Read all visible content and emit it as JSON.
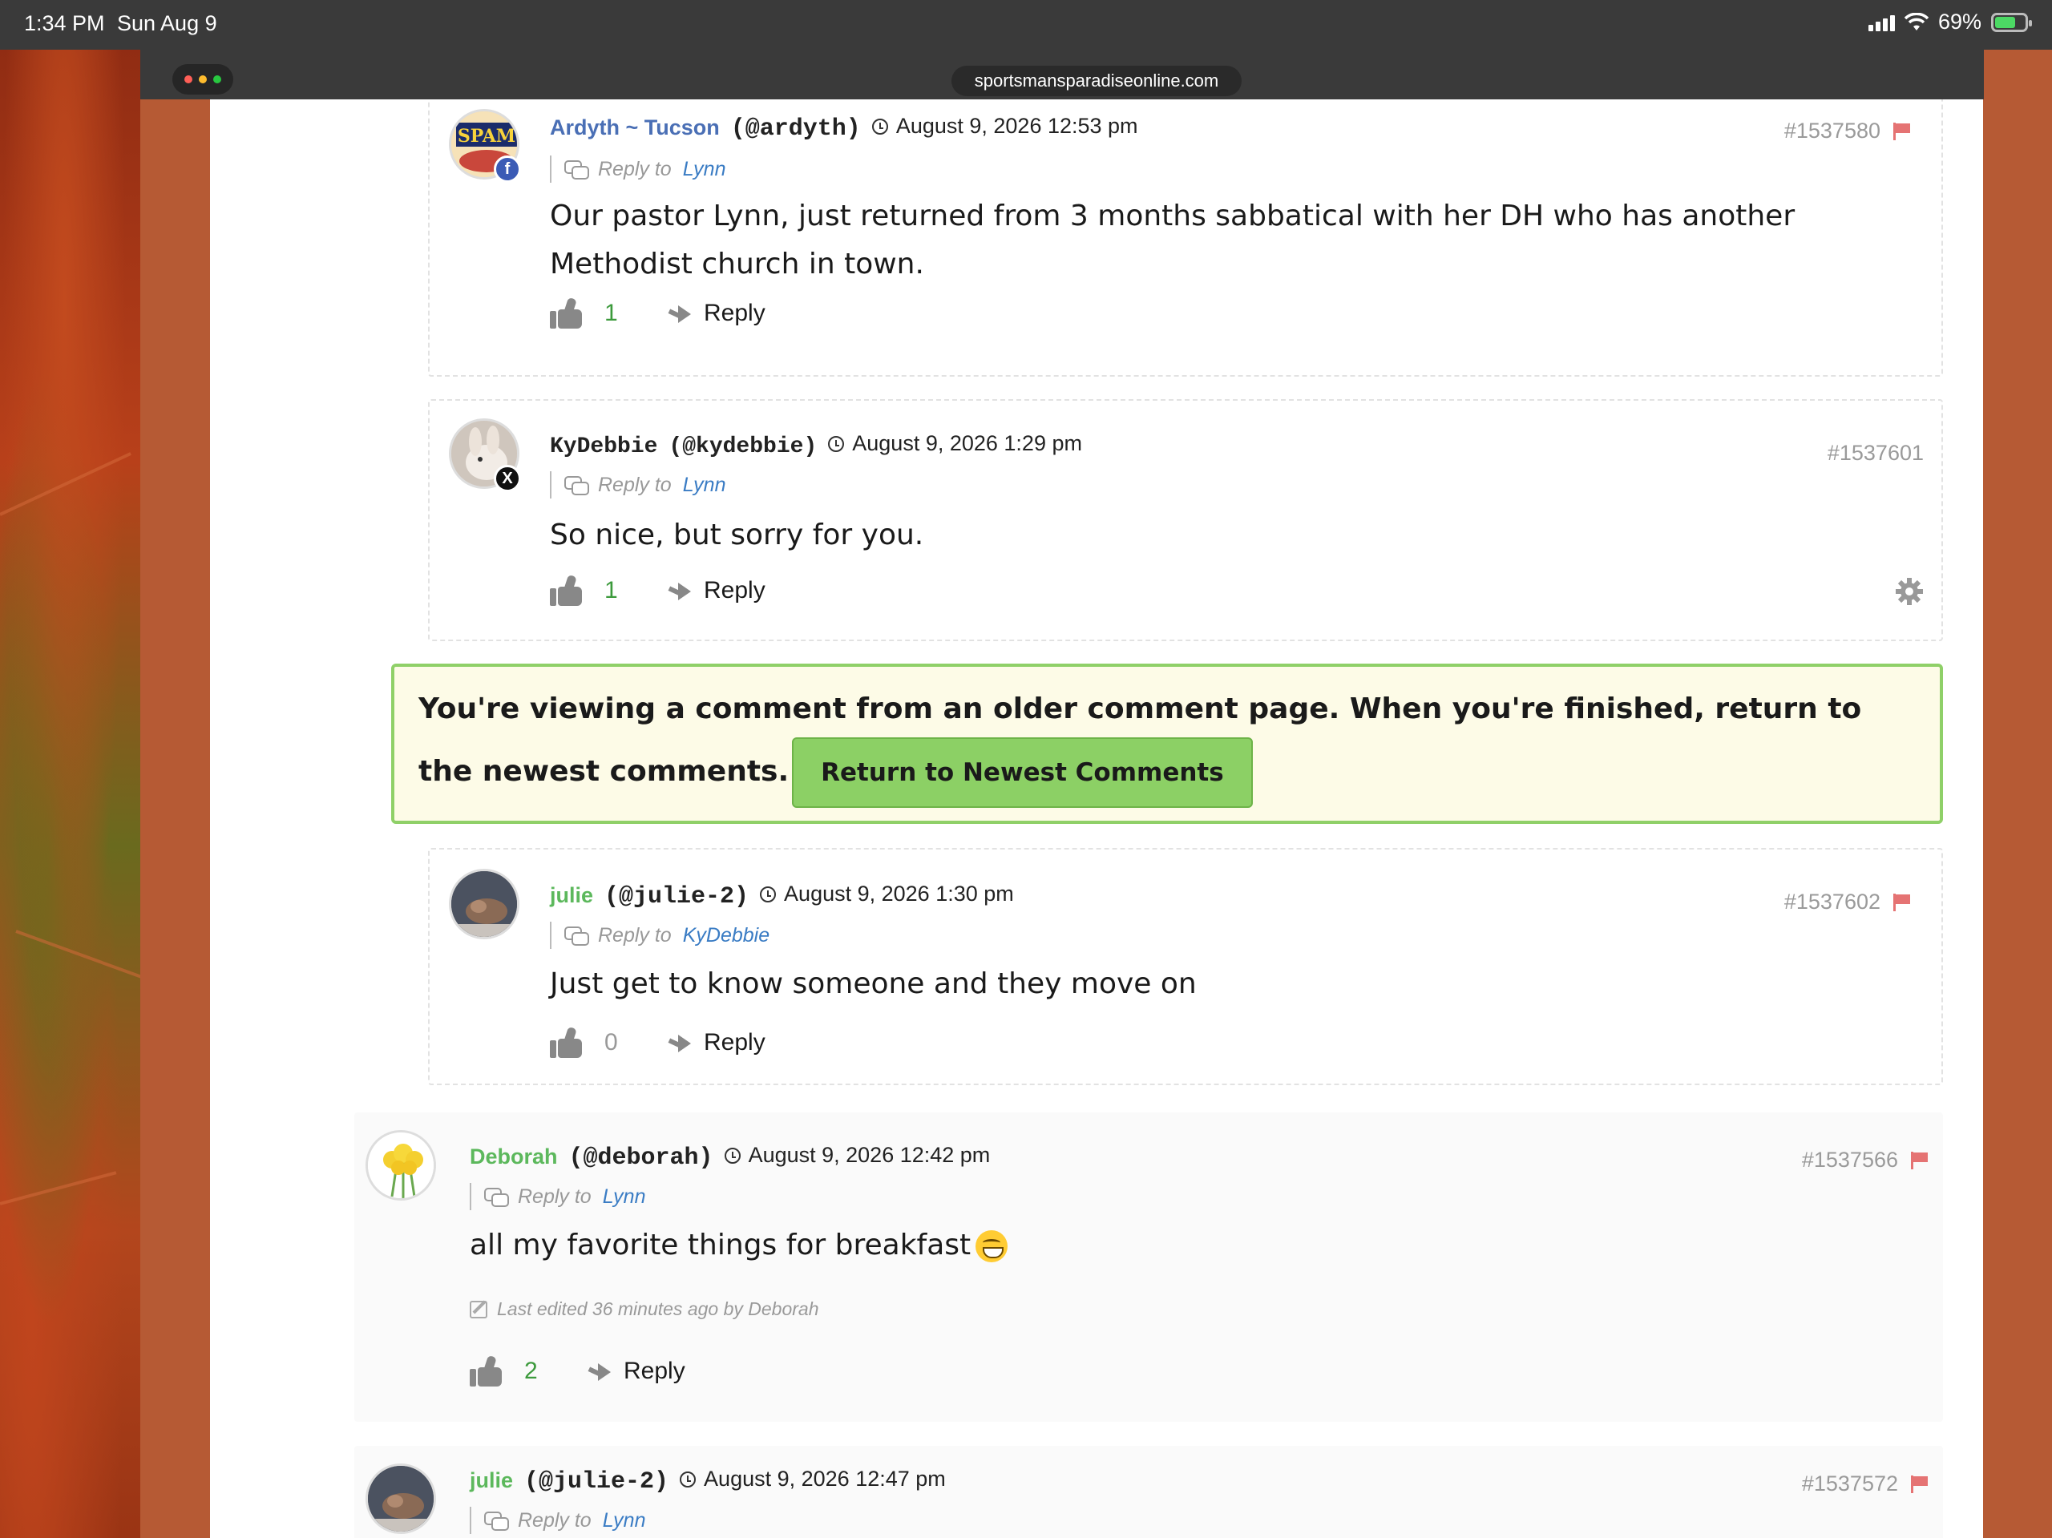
{
  "status_bar": {
    "time": "1:34 PM",
    "date": "Sun Aug 9",
    "battery": "69%"
  },
  "browser": {
    "url": "sportsmansparadiseonline.com"
  },
  "comments": [
    {
      "author": "Ardyth ~ Tucson",
      "handle": "(@ardyth)",
      "date": "August 9, 2026 12:53 pm",
      "reply_label": "Reply to",
      "reply_to": "Lynn",
      "text": "Our pastor Lynn, just returned from 3 months sabbatical with her DH who has another Methodist church in town.",
      "votes": "1",
      "reply": "Reply",
      "id": "#1537580",
      "author_color": "#4a6fb5",
      "social": "f"
    },
    {
      "author": "KyDebbie",
      "handle": "(@kydebbie)",
      "date": "August 9, 2026 1:29 pm",
      "reply_label": "Reply to",
      "reply_to": "Lynn",
      "text": "So nice, but sorry for you.",
      "votes": "1",
      "reply": "Reply",
      "id": "#1537601",
      "social": "X"
    },
    {
      "author": "julie",
      "handle": "(@julie-2)",
      "date": "August 9, 2026 1:30 pm",
      "reply_label": "Reply to",
      "reply_to": "KyDebbie",
      "text": "Just get to know someone and they move on",
      "votes": "0",
      "reply": "Reply",
      "id": "#1537602",
      "author_color": "#5cb85c"
    },
    {
      "author": "Deborah",
      "handle": "(@deborah)",
      "date": "August 9, 2026 12:42 pm",
      "reply_label": "Reply to",
      "reply_to": "Lynn",
      "text": "all my favorite things for breakfast",
      "edited": "Last edited 36 minutes ago by Deborah",
      "votes": "2",
      "reply": "Reply",
      "id": "#1537566",
      "author_color": "#5cb85c"
    },
    {
      "author": "julie",
      "handle": "(@julie-2)",
      "date": "August 9, 2026 12:47 pm",
      "reply_label": "Reply to",
      "reply_to": "Lynn",
      "id": "#1537572",
      "author_color": "#5cb85c"
    }
  ],
  "notice": {
    "text": "You're viewing a comment from an older comment page. When you're finished, return to the newest comments.",
    "button": "Return to Newest Comments"
  },
  "colors": {
    "vote_positive": "#3c9a3c",
    "vote_zero": "#999999",
    "link": "#3a7cc4",
    "flag": "#e57373",
    "notice_border": "#8fd068",
    "notice_bg": "#fdfbe7"
  }
}
